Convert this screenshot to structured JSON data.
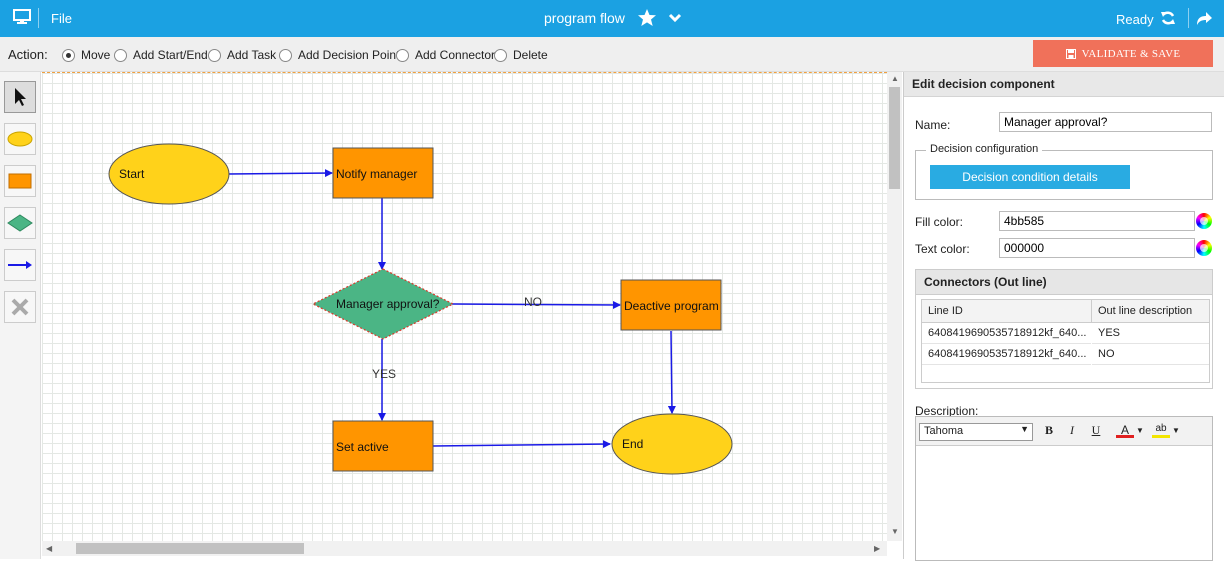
{
  "topbar": {
    "file_label": "File",
    "title": "program flow",
    "status": "Ready"
  },
  "actionbar": {
    "label": "Action:",
    "options": [
      {
        "label": "Move",
        "selected": true
      },
      {
        "label": "Add Start/End",
        "selected": false
      },
      {
        "label": "Add Task",
        "selected": false
      },
      {
        "label": "Add Decision Point",
        "selected": false
      },
      {
        "label": "Add Connector",
        "selected": false
      },
      {
        "label": "Delete",
        "selected": false
      }
    ],
    "validate_label": "VALIDATE & SAVE"
  },
  "diagram": {
    "nodes": {
      "start": "Start",
      "notify": "Notify manager",
      "decision": "Manager approval?",
      "deactive": "Deactive program",
      "setactive": "Set active",
      "end": "End"
    },
    "edge_labels": {
      "no": "NO",
      "yes": "YES"
    },
    "colors": {
      "ellipse": "#ffd21a",
      "task": "#ff9500",
      "decision": "#4bb585",
      "edge": "#1a1ae6"
    }
  },
  "panel": {
    "header": "Edit decision component",
    "name_label": "Name:",
    "name_value": "Manager approval?",
    "decision_config_legend": "Decision configuration",
    "decision_details_button": "Decision condition details",
    "fill_color_label": "Fill color:",
    "fill_color_value": "4bb585",
    "text_color_label": "Text color:",
    "text_color_value": "000000",
    "connectors": {
      "header": "Connectors (Out line)",
      "columns": [
        "Line ID",
        "Out line description"
      ],
      "rows": [
        {
          "id": "6408419690535718912kf_640...",
          "desc": "YES"
        },
        {
          "id": "6408419690535718912kf_640...",
          "desc": "NO"
        }
      ]
    },
    "description_label": "Description:",
    "editor": {
      "font": "Tahoma",
      "bold": "B",
      "italic": "I",
      "underline": "U",
      "font_color": "A",
      "highlight": "ab"
    }
  }
}
